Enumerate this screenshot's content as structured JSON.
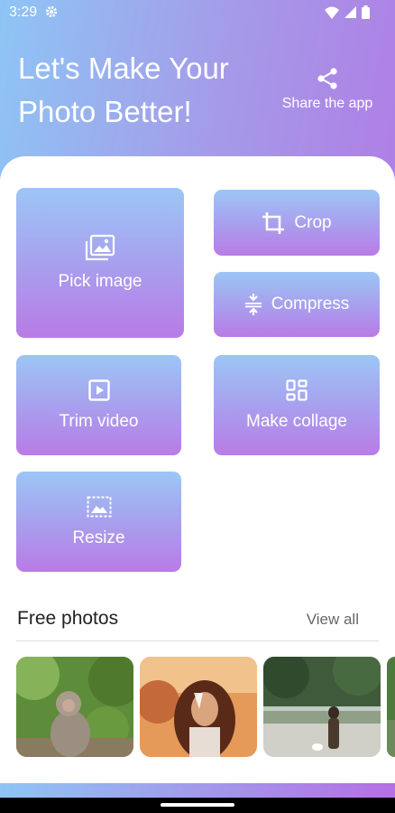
{
  "status_bar": {
    "time": "3:29"
  },
  "header": {
    "headline_line1": "Let's Make Your",
    "headline_line2": "Photo Better!",
    "share_label": "Share the app"
  },
  "tiles": {
    "pick_image": "Pick image",
    "crop": "Crop",
    "compress": "Compress",
    "trim_video": "Trim video",
    "make_collage": "Make collage",
    "resize": "Resize"
  },
  "free_photos": {
    "title": "Free photos",
    "view_all": "View all"
  },
  "colors": {
    "gradient_start": "#8ec5f5",
    "gradient_end": "#b56fe4",
    "tile_top": "#9cc6f5",
    "tile_bottom": "#b97be6"
  },
  "icons": [
    "settings-icon",
    "wifi-icon",
    "cell-signal-icon",
    "battery-icon",
    "share-icon",
    "image-icon",
    "crop-icon",
    "compress-icon",
    "play-video-icon",
    "collage-grid-icon",
    "resize-icon"
  ]
}
